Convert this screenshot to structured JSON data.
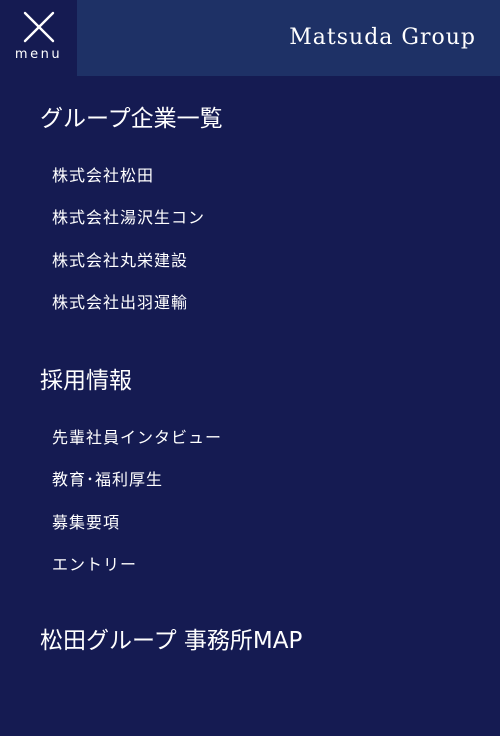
{
  "header": {
    "menu_label": "menu",
    "brand": "Matsuda Group"
  },
  "nav": {
    "group_companies": {
      "title": "グループ企業一覧",
      "items": [
        "株式会社松田",
        "株式会社湯沢生コン",
        "株式会社丸栄建設",
        "株式会社出羽運輸"
      ]
    },
    "recruit": {
      "title": "採用情報",
      "items": [
        "先輩社員インタビュー",
        "教育･福利厚生",
        "募集要項",
        "エントリー"
      ]
    },
    "map_link": "松田グループ 事務所MAP"
  },
  "colors": {
    "background": "#151b52",
    "brand_bar": "#1e3166",
    "text": "#ffffff"
  },
  "icons": {
    "menu_close": "close-icon"
  }
}
